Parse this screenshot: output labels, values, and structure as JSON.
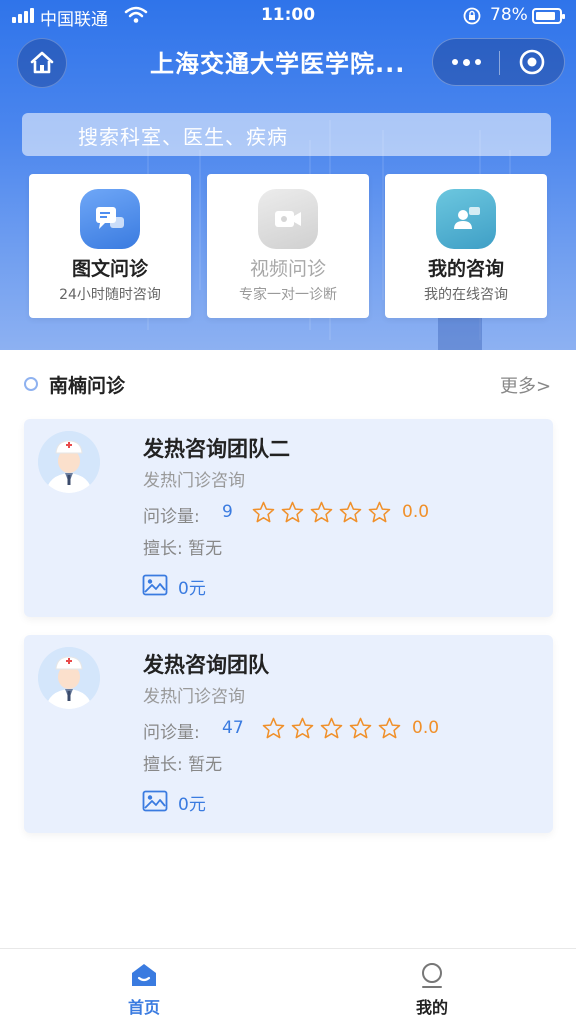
{
  "status_bar": {
    "carrier": "中国联通",
    "time": "11:00",
    "battery": "78%"
  },
  "nav": {
    "title": "上海交通大学医学院...",
    "home_icon": "home-icon",
    "more_icon": "more-dots-icon",
    "target_icon": "target-icon"
  },
  "search": {
    "placeholder": "搜索科室、医生、疾病"
  },
  "services": [
    {
      "title": "图文问诊",
      "subtitle": "24小时随时咨询",
      "icon": "chat-icon",
      "color": "#4f8ef0"
    },
    {
      "title": "视频问诊",
      "subtitle": "专家一对一诊断",
      "icon": "video-icon",
      "color": "#d6d6d6"
    },
    {
      "title": "我的咨询",
      "subtitle": "我的在线咨询",
      "icon": "consult-user-icon",
      "color": "#4ab0d0"
    }
  ],
  "section": {
    "title": "南楠问诊",
    "more": "更多>"
  },
  "cards": [
    {
      "name": "发热咨询团队二",
      "dept": "发热门诊咨询",
      "volume_label": "问诊量:",
      "volume": "9",
      "rating": "0.0",
      "skill": "擅长: 暂无",
      "price": "0元"
    },
    {
      "name": "发热咨询团队",
      "dept": "发热门诊咨询",
      "volume_label": "问诊量:",
      "volume": "47",
      "rating": "0.0",
      "skill": "擅长: 暂无",
      "price": "0元"
    }
  ],
  "tabbar": {
    "home": "首页",
    "mine": "我的",
    "active_color": "#3a7be0"
  }
}
